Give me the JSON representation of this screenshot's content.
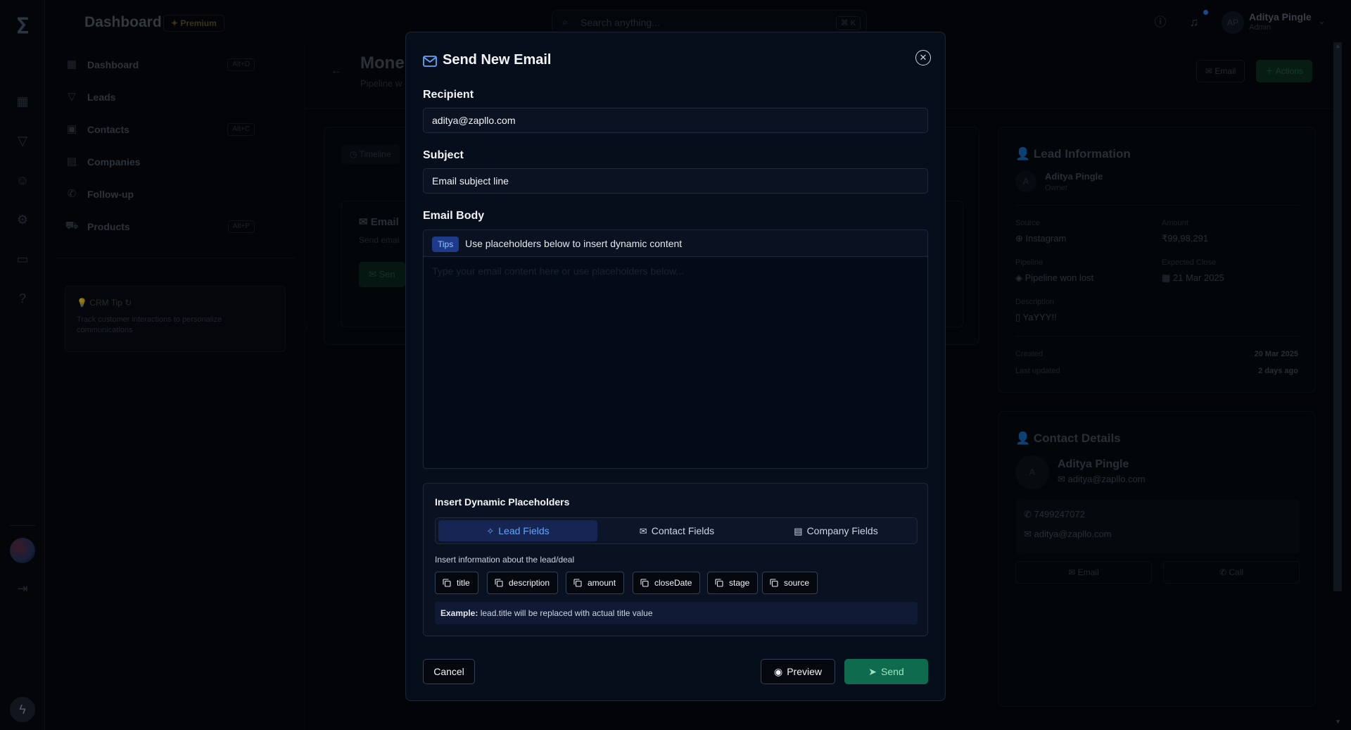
{
  "app": {
    "title": "Dashboard",
    "premium_label": "Premium",
    "search_placeholder": "Search anything...",
    "search_shortcut": "⌘ K",
    "user": {
      "initials": "AP",
      "name": "Aditya Pingle",
      "role": "Admin"
    }
  },
  "sidebar": {
    "items": [
      {
        "label": "Dashboard",
        "shortcut": "Alt+D"
      },
      {
        "label": "Leads",
        "shortcut": ""
      },
      {
        "label": "Contacts",
        "shortcut": "Alt+C"
      },
      {
        "label": "Companies",
        "shortcut": ""
      },
      {
        "label": "Follow-up",
        "shortcut": ""
      },
      {
        "label": "Products",
        "shortcut": "Alt+P"
      }
    ],
    "tip": {
      "title": "CRM Tip",
      "text": "Track customer interactions to personalize communications"
    }
  },
  "main": {
    "title": "Mone",
    "subtitle": "Pipeline w",
    "email_button": "Email",
    "actions_button": "Actions",
    "timeline_tab": "Timeline",
    "email_card_title": "Email",
    "email_card_desc": "Send emai",
    "send_button": "Sen"
  },
  "lead_info": {
    "title": "Lead Information",
    "owner_initial": "A",
    "owner_name": "Aditya Pingle",
    "owner_role": "Owner",
    "source_label": "Source",
    "source": "Instagram",
    "amount_label": "Amount",
    "amount": "₹99,98,291",
    "pipeline_label": "Pipeline",
    "pipeline": "Pipeline won lost",
    "close_label": "Expected Close",
    "close": "21 Mar 2025",
    "desc_label": "Description",
    "desc": "YaYYY!!",
    "created_label": "Created",
    "created": "20 Mar 2025",
    "updated_label": "Last updated",
    "updated": "2 days ago"
  },
  "contact": {
    "title": "Contact Details",
    "initial": "A",
    "name": "Aditya Pingle",
    "email": "aditya@zapllo.com",
    "phone": "7499247072",
    "email_button": "Email",
    "call_button": "Call"
  },
  "modal": {
    "title": "Send New Email",
    "recipient_label": "Recipient",
    "recipient_value": "aditya@zapllo.com",
    "subject_label": "Subject",
    "subject_placeholder": "Email subject line",
    "body_label": "Email Body",
    "tips_badge": "Tips",
    "tips_text": "Use placeholders below to insert dynamic content",
    "body_placeholder": "Type your email content here or use placeholders below...",
    "placeholders_title": "Insert Dynamic Placeholders",
    "tabs": [
      "Lead Fields",
      "Contact Fields",
      "Company Fields"
    ],
    "fields_desc": "Insert information about the lead/deal",
    "chips": [
      "title",
      "description",
      "amount",
      "closeDate",
      "stage",
      "source"
    ],
    "example_label": "Example:",
    "example_text": " lead.title will be replaced with actual title value",
    "cancel": "Cancel",
    "preview": "Preview",
    "send": "Send"
  },
  "colors": {
    "accent": "#60a5fa",
    "send": "#0f6b4d",
    "tab_active": "#172554"
  }
}
